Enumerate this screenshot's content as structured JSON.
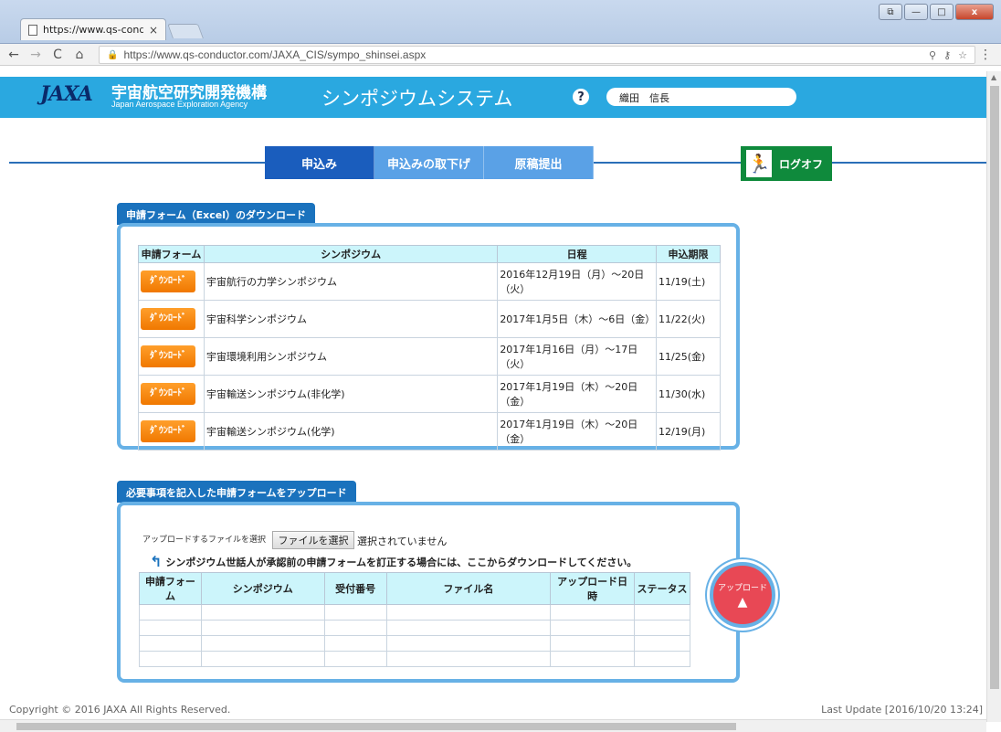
{
  "browser": {
    "tab_title": "https://www.qs-cond",
    "tab_close": "×",
    "url": "https://www.qs-conductor.com/JAXA_CIS/sympo_shinsei.aspx",
    "back_icon": "←",
    "forward_icon": "→",
    "reload_icon": "C",
    "home_icon": "⌂",
    "zoom_icon": "⚲",
    "key_icon": "⚷",
    "star_icon": "☆",
    "menu_icon": "⋮",
    "window_buttons": {
      "restore": "⧉",
      "minimize": "—",
      "maximize": "□",
      "close": "x"
    }
  },
  "header": {
    "logo": "JAXA",
    "org_ja": "宇宙航空研究開発機構",
    "org_en": "Japan Aerospace Exploration Agency",
    "system_title": "シンポジウムシステム",
    "help": "?",
    "user_name": "織田　信長"
  },
  "nav": {
    "tabs": [
      {
        "label": "申込み",
        "active": true
      },
      {
        "label": "申込みの取下げ",
        "active": false
      },
      {
        "label": "原稿提出",
        "active": false
      }
    ],
    "logoff": "ログオフ",
    "logoff_icon": "exit-icon"
  },
  "download_section": {
    "title": "申請フォーム（Excel）のダウンロード",
    "headers": [
      "申請フォーム",
      "シンポジウム",
      "日程",
      "申込期限"
    ],
    "button_label": "ﾀﾞｳﾝﾛｰﾄﾞ",
    "rows": [
      {
        "symposium": "宇宙航行の力学シンポジウム",
        "schedule": "2016年12月19日（月）～20日（火）",
        "deadline": "11/19(土)"
      },
      {
        "symposium": "宇宙科学シンポジウム",
        "schedule": "2017年1月5日（木）～6日（金）",
        "deadline": "11/22(火)"
      },
      {
        "symposium": "宇宙環境利用シンポジウム",
        "schedule": "2017年1月16日（月）～17日（火）",
        "deadline": "11/25(金)"
      },
      {
        "symposium": "宇宙輸送シンポジウム(非化学)",
        "schedule": "2017年1月19日（木）～20日（金）",
        "deadline": "11/30(水)"
      },
      {
        "symposium": "宇宙輸送シンポジウム(化学)",
        "schedule": "2017年1月19日（木）～20日（金）",
        "deadline": "12/19(月)"
      }
    ]
  },
  "upload_section": {
    "title": "必要事項を記入した申請フォームをアップロード",
    "file_label": "アップロードするファイルを選択",
    "file_button": "ファイルを選択",
    "file_status": "選択されていません",
    "note": "シンポジウム世話人が承認前の申請フォームを訂正する場合には、ここからダウンロードしてください。",
    "headers": [
      "申請フォーム",
      "シンポジウム",
      "受付番号",
      "ファイル名",
      "アップロード日時",
      "ステータス"
    ],
    "upload_button": "アップロード"
  },
  "footer": {
    "copyright": "Copyright © 2016 JAXA All Rights Reserved.",
    "last_update": "Last Update [2016/10/20 13:24]"
  }
}
